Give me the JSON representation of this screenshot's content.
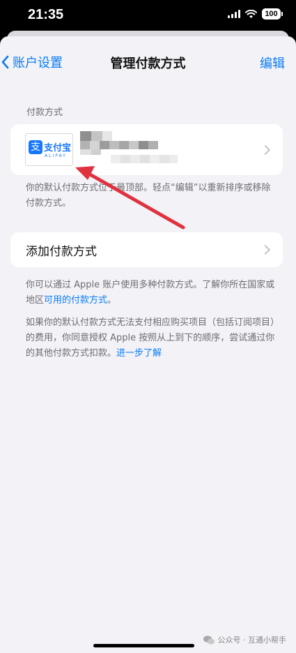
{
  "status": {
    "time": "21:35",
    "battery": "100"
  },
  "nav": {
    "back_label": "账户设置",
    "title": "管理付款方式",
    "edit_label": "编辑"
  },
  "payment_section": {
    "header": "付款方式",
    "method": {
      "logo_text": "支付宝",
      "logo_subtext": "ALIPAY",
      "logo_glyph": "支"
    },
    "footer": "你的默认付款方式位于最顶部。轻点“编辑”以重新排序或移除付款方式。"
  },
  "add_payment": {
    "label": "添加付款方式"
  },
  "info1": {
    "text": "你可以通过 Apple 账户使用多种付款方式。了解你所在国家或地区",
    "link": "可用的付款方式",
    "suffix": "。"
  },
  "info2": {
    "text": "如果你的默认付款方式无法支付相应购买项目（包括订阅项目）的费用，你同意授权 Apple 按照从上到下的顺序，尝试通过你的其他付款方式扣款。",
    "link": "进一步了解"
  },
  "watermark": {
    "text": "公众号 · 互通小帮手"
  },
  "colors": {
    "accent": "#0a7cf6",
    "background": "#f2f2f7",
    "annotation_arrow": "#e0323e"
  }
}
